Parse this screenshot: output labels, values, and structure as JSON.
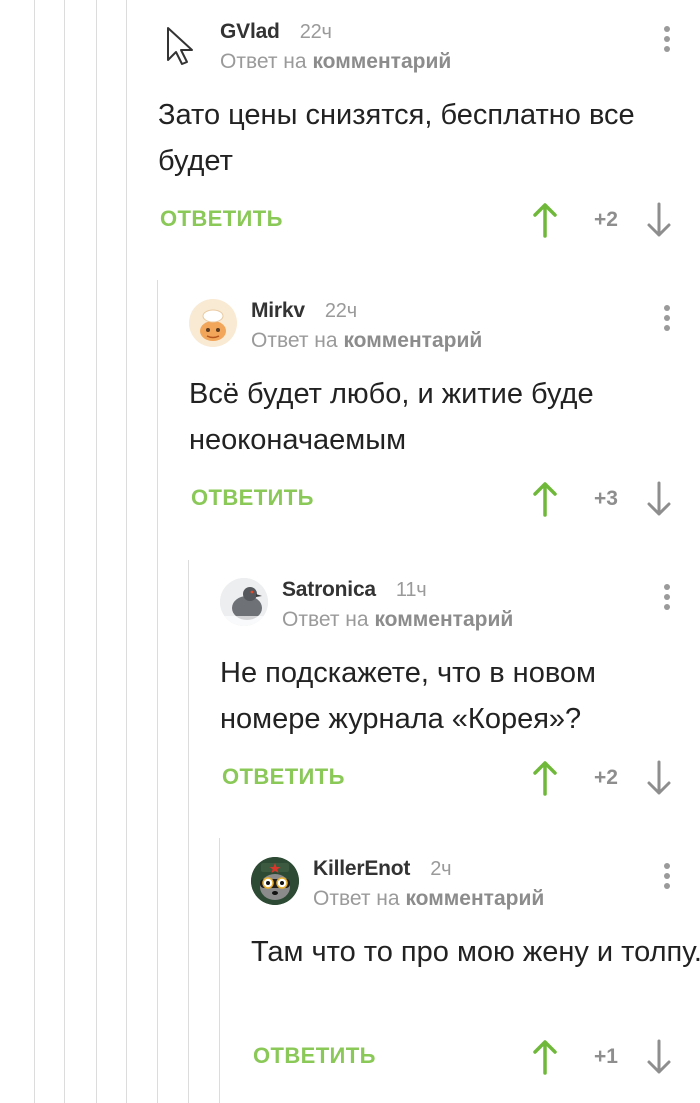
{
  "comments": [
    {
      "author": "GVlad",
      "time": "22ч",
      "reply_prefix": "Ответ на",
      "reply_link": "комментарий",
      "text": "Зато цены снизятся, бесплатно все будет",
      "reply_label": "ОТВЕТИТЬ",
      "score": "+2",
      "avatar": "cursor-icon"
    },
    {
      "author": "Mirkv",
      "time": "22ч",
      "reply_prefix": "Ответ на",
      "reply_link": "комментарий",
      "text": "Всё будет любо, и житие буде неоконачаемым",
      "reply_label": "ОТВЕТИТЬ",
      "score": "+3",
      "avatar": "cartoon-avatar"
    },
    {
      "author": "Satronica",
      "time": "11ч",
      "reply_prefix": "Ответ на",
      "reply_link": "комментарий",
      "text": "Не подскажете, что в новом номере журнала «Корея»?",
      "reply_label": "ОТВЕТИТЬ",
      "score": "+2",
      "avatar": "pigeon-avatar"
    },
    {
      "author": "KillerEnot",
      "time": "2ч",
      "reply_prefix": "Ответ на",
      "reply_link": "комментарий",
      "text": "Там что то про мою жену и толпу.",
      "reply_label": "ОТВЕТИТЬ",
      "score": "+1",
      "avatar": "raccoon-avatar"
    }
  ],
  "colors": {
    "accent_green": "#8ac858",
    "upvote_green": "#6fb83a",
    "muted_gray": "#9a9a9a",
    "thread_line": "#dcdcdc"
  }
}
